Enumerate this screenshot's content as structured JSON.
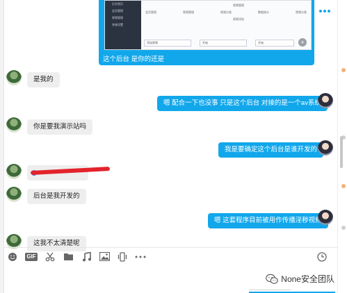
{
  "header": {
    "icons": [
      "phone-icon",
      "video-icon",
      "more-icon"
    ]
  },
  "image_message": {
    "sidebar_items": [
      "后台首页",
      "会员管理",
      "视频管理",
      "系统设置"
    ],
    "table_header": [
      "会员管理",
      "视频管理",
      "视频分类",
      "数据统计",
      "视频分类"
    ],
    "table_subheader": [
      "视频管理",
      "视频添加"
    ],
    "inputs": [
      "添加视频",
      "开始",
      "开始"
    ],
    "caption": "这个后台 是你的还是"
  },
  "messages": [
    {
      "side": "left",
      "text": "是我的"
    },
    {
      "side": "right",
      "text": "嗯  配合一下也没事  只是这个后台 对接的是一个av系统"
    },
    {
      "side": "left",
      "text": "你是要我演示站吗"
    },
    {
      "side": "right",
      "text": "我是要确定这个后台是谁开发的"
    },
    {
      "side": "left",
      "text": ""
    },
    {
      "side": "left",
      "text": "后台是我开发的"
    },
    {
      "side": "right",
      "text": "嗯  这套程序目前被用作传播淫秽视频"
    },
    {
      "side": "left",
      "text": "这我不太清楚呢"
    }
  ],
  "toolbar": {
    "gif_label": "GIF",
    "tools": [
      "emoji-icon",
      "gif-icon",
      "scissors-icon",
      "folder-icon",
      "music-icon",
      "image-icon",
      "phone-shake-icon",
      "more-icon",
      "history-clock-icon"
    ]
  },
  "watermark": {
    "text": "None安全团队"
  },
  "colors": {
    "accent": "#12a7eb",
    "incoming_bubble": "#eeeeee",
    "redaction": "#e3232b"
  }
}
